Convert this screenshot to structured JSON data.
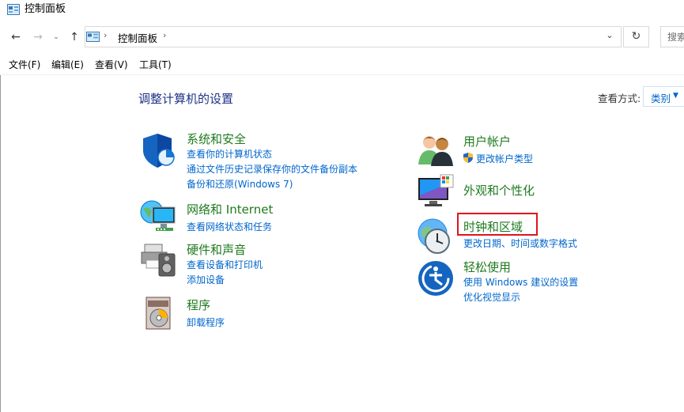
{
  "window": {
    "title": "控制面板"
  },
  "address_bar": {
    "path": "控制面板",
    "separator": "›",
    "dropdown_glyph": "⌄",
    "refresh_glyph": "↻",
    "search_placeholder": "搜索"
  },
  "nav": {
    "back": "←",
    "forward": "→",
    "recent": "⌄",
    "up": "↑"
  },
  "menu": [
    {
      "label": "文件(F)"
    },
    {
      "label": "编辑(E)"
    },
    {
      "label": "查看(V)"
    },
    {
      "label": "工具(T)"
    }
  ],
  "content": {
    "title": "调整计算机的设置",
    "view_by_label": "查看方式:",
    "view_by_value": "类别",
    "view_by_arrow": "▼"
  },
  "categories_left": [
    {
      "title": "系统和安全",
      "icon": "shield-icon",
      "links": [
        "查看你的计算机状态",
        "通过文件历史记录保存你的文件备份副本",
        "备份和还原(Windows 7)"
      ]
    },
    {
      "title": "网络和 Internet",
      "icon": "network-globe-icon",
      "links": [
        "查看网络状态和任务"
      ]
    },
    {
      "title": "硬件和声音",
      "icon": "printer-speaker-icon",
      "links": [
        "查看设备和打印机",
        "添加设备"
      ]
    },
    {
      "title": "程序",
      "icon": "programs-disk-icon",
      "links": [
        "卸载程序"
      ]
    }
  ],
  "categories_right": [
    {
      "title": "用户帐户",
      "icon": "users-icon",
      "links": [
        "更改帐户类型"
      ],
      "link_icon": "uac-shield-icon"
    },
    {
      "title": "外观和个性化",
      "icon": "monitor-palette-icon",
      "links": []
    },
    {
      "title": "时钟和区域",
      "icon": "clock-globe-icon",
      "links": [
        "更改日期、时间或数字格式"
      ],
      "highlighted": true,
      "highlight_color": "#e0141e"
    },
    {
      "title": "轻松使用",
      "icon": "ease-of-access-icon",
      "links": [
        "使用 Windows 建议的设置",
        "优化视觉显示"
      ]
    }
  ],
  "colors": {
    "category_title": "#1f7a1f",
    "link": "#0066cc",
    "page_title": "#1e3287",
    "highlight": "#e0141e"
  }
}
